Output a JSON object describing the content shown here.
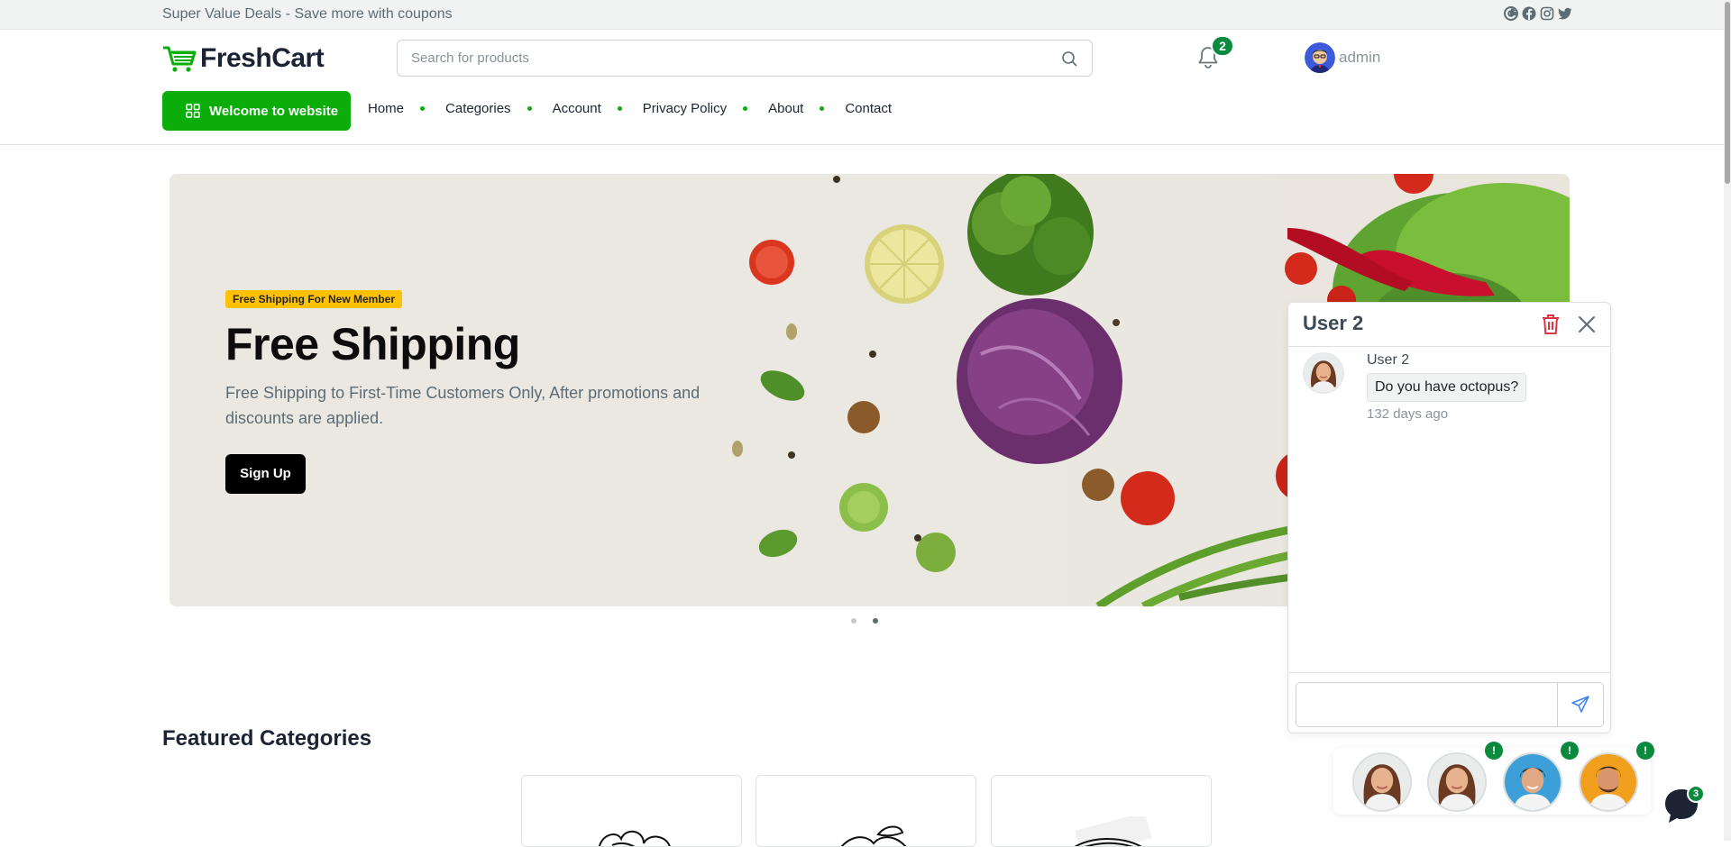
{
  "topbar": {
    "promo_text": "Super Value Deals - Save more with coupons",
    "social_icons": [
      "google-icon",
      "facebook-icon",
      "instagram-icon",
      "twitter-icon"
    ]
  },
  "header": {
    "logo_text": "FreshCart",
    "search_placeholder": "Search for products",
    "notifications_count": "2",
    "user_name": "admin"
  },
  "nav": {
    "welcome_label": "Welcome to website",
    "items": [
      "Home",
      "Categories",
      "Account",
      "Privacy Policy",
      "About",
      "Contact"
    ]
  },
  "hero": {
    "badge": "Free Shipping For New Member",
    "title": "Free Shipping",
    "subtitle": "Free Shipping to First-Time Customers Only, After promotions and discounts are applied.",
    "button": "Sign Up",
    "slides_total": 2,
    "active_slide": 2
  },
  "featured": {
    "title": "Featured Categories"
  },
  "chat": {
    "title": "User 2",
    "messages": [
      {
        "user": "User 2",
        "text": "Do you have octopus?",
        "time": "132 days ago"
      }
    ],
    "input_value": ""
  },
  "chat_tray": {
    "alert_badge": "!",
    "messenger_count": "3"
  },
  "colors": {
    "brand_green": "#0aad0a",
    "badge_green": "#0a8a3c",
    "badge_yellow": "#ffc107",
    "trash_red": "#dc3545"
  }
}
